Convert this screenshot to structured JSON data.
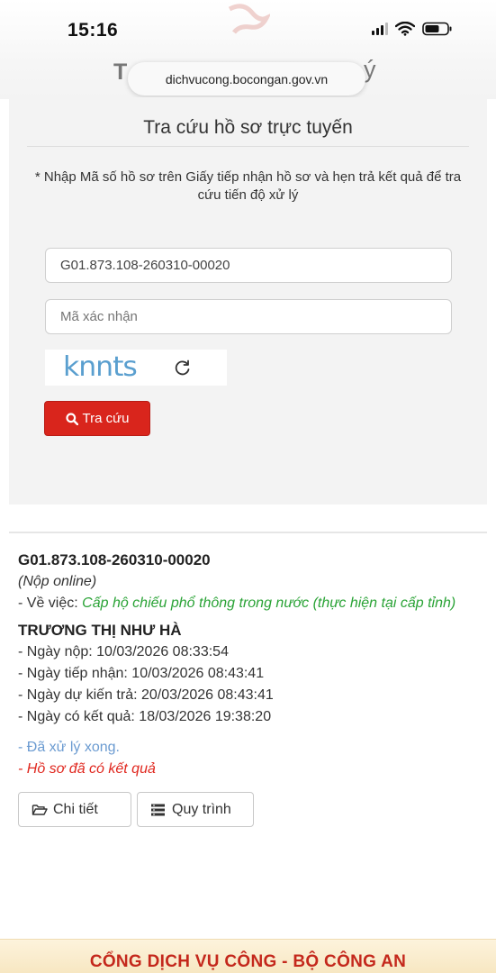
{
  "status_bar": {
    "time": "15:16"
  },
  "browser": {
    "url": "dichvucong.bocongan.gov.vn",
    "bg_title_left": "T",
    "bg_title_right": "ý"
  },
  "search_card": {
    "title": "Tra cứu hồ sơ trực tuyến",
    "instructions": "* Nhập Mã số hồ sơ trên Giấy tiếp nhận hồ sơ và hẹn trả kết quả để tra cứu tiến độ xử lý",
    "code_input_value": "G01.873.108-260310-00020",
    "captcha_placeholder": "Mã xác nhận",
    "captcha_text": "knnts",
    "search_button_label": "Tra cứu"
  },
  "result": {
    "case_code": "G01.873.108-260310-00020",
    "submission_type": "(Nộp online)",
    "subject_label": "- Về việc: ",
    "subject_value": "Cấp hộ chiếu phổ thông trong nước (thực hiện tại cấp tỉnh)",
    "applicant_name": "TRƯƠNG THỊ NHƯ HÀ",
    "dates": [
      "- Ngày nộp: 10/03/2026 08:33:54",
      "- Ngày tiếp nhận: 10/03/2026 08:43:41",
      "- Ngày dự kiến trả: 20/03/2026 08:43:41",
      "- Ngày có kết quả: 18/03/2026 19:38:20"
    ],
    "status_processed": "- Đã xử lý xong.",
    "status_result": "- Hồ sơ đã có kết quả",
    "detail_button_label": "Chi tiết",
    "process_button_label": "Quy trình"
  },
  "footer": {
    "text": "CỔNG DỊCH VỤ CÔNG - BỘ CÔNG AN"
  },
  "colors": {
    "primary_red": "#d9251c",
    "success_green": "#2aa336",
    "info_blue": "#6b9bd1",
    "footer_bg": "#f7e7c2"
  }
}
